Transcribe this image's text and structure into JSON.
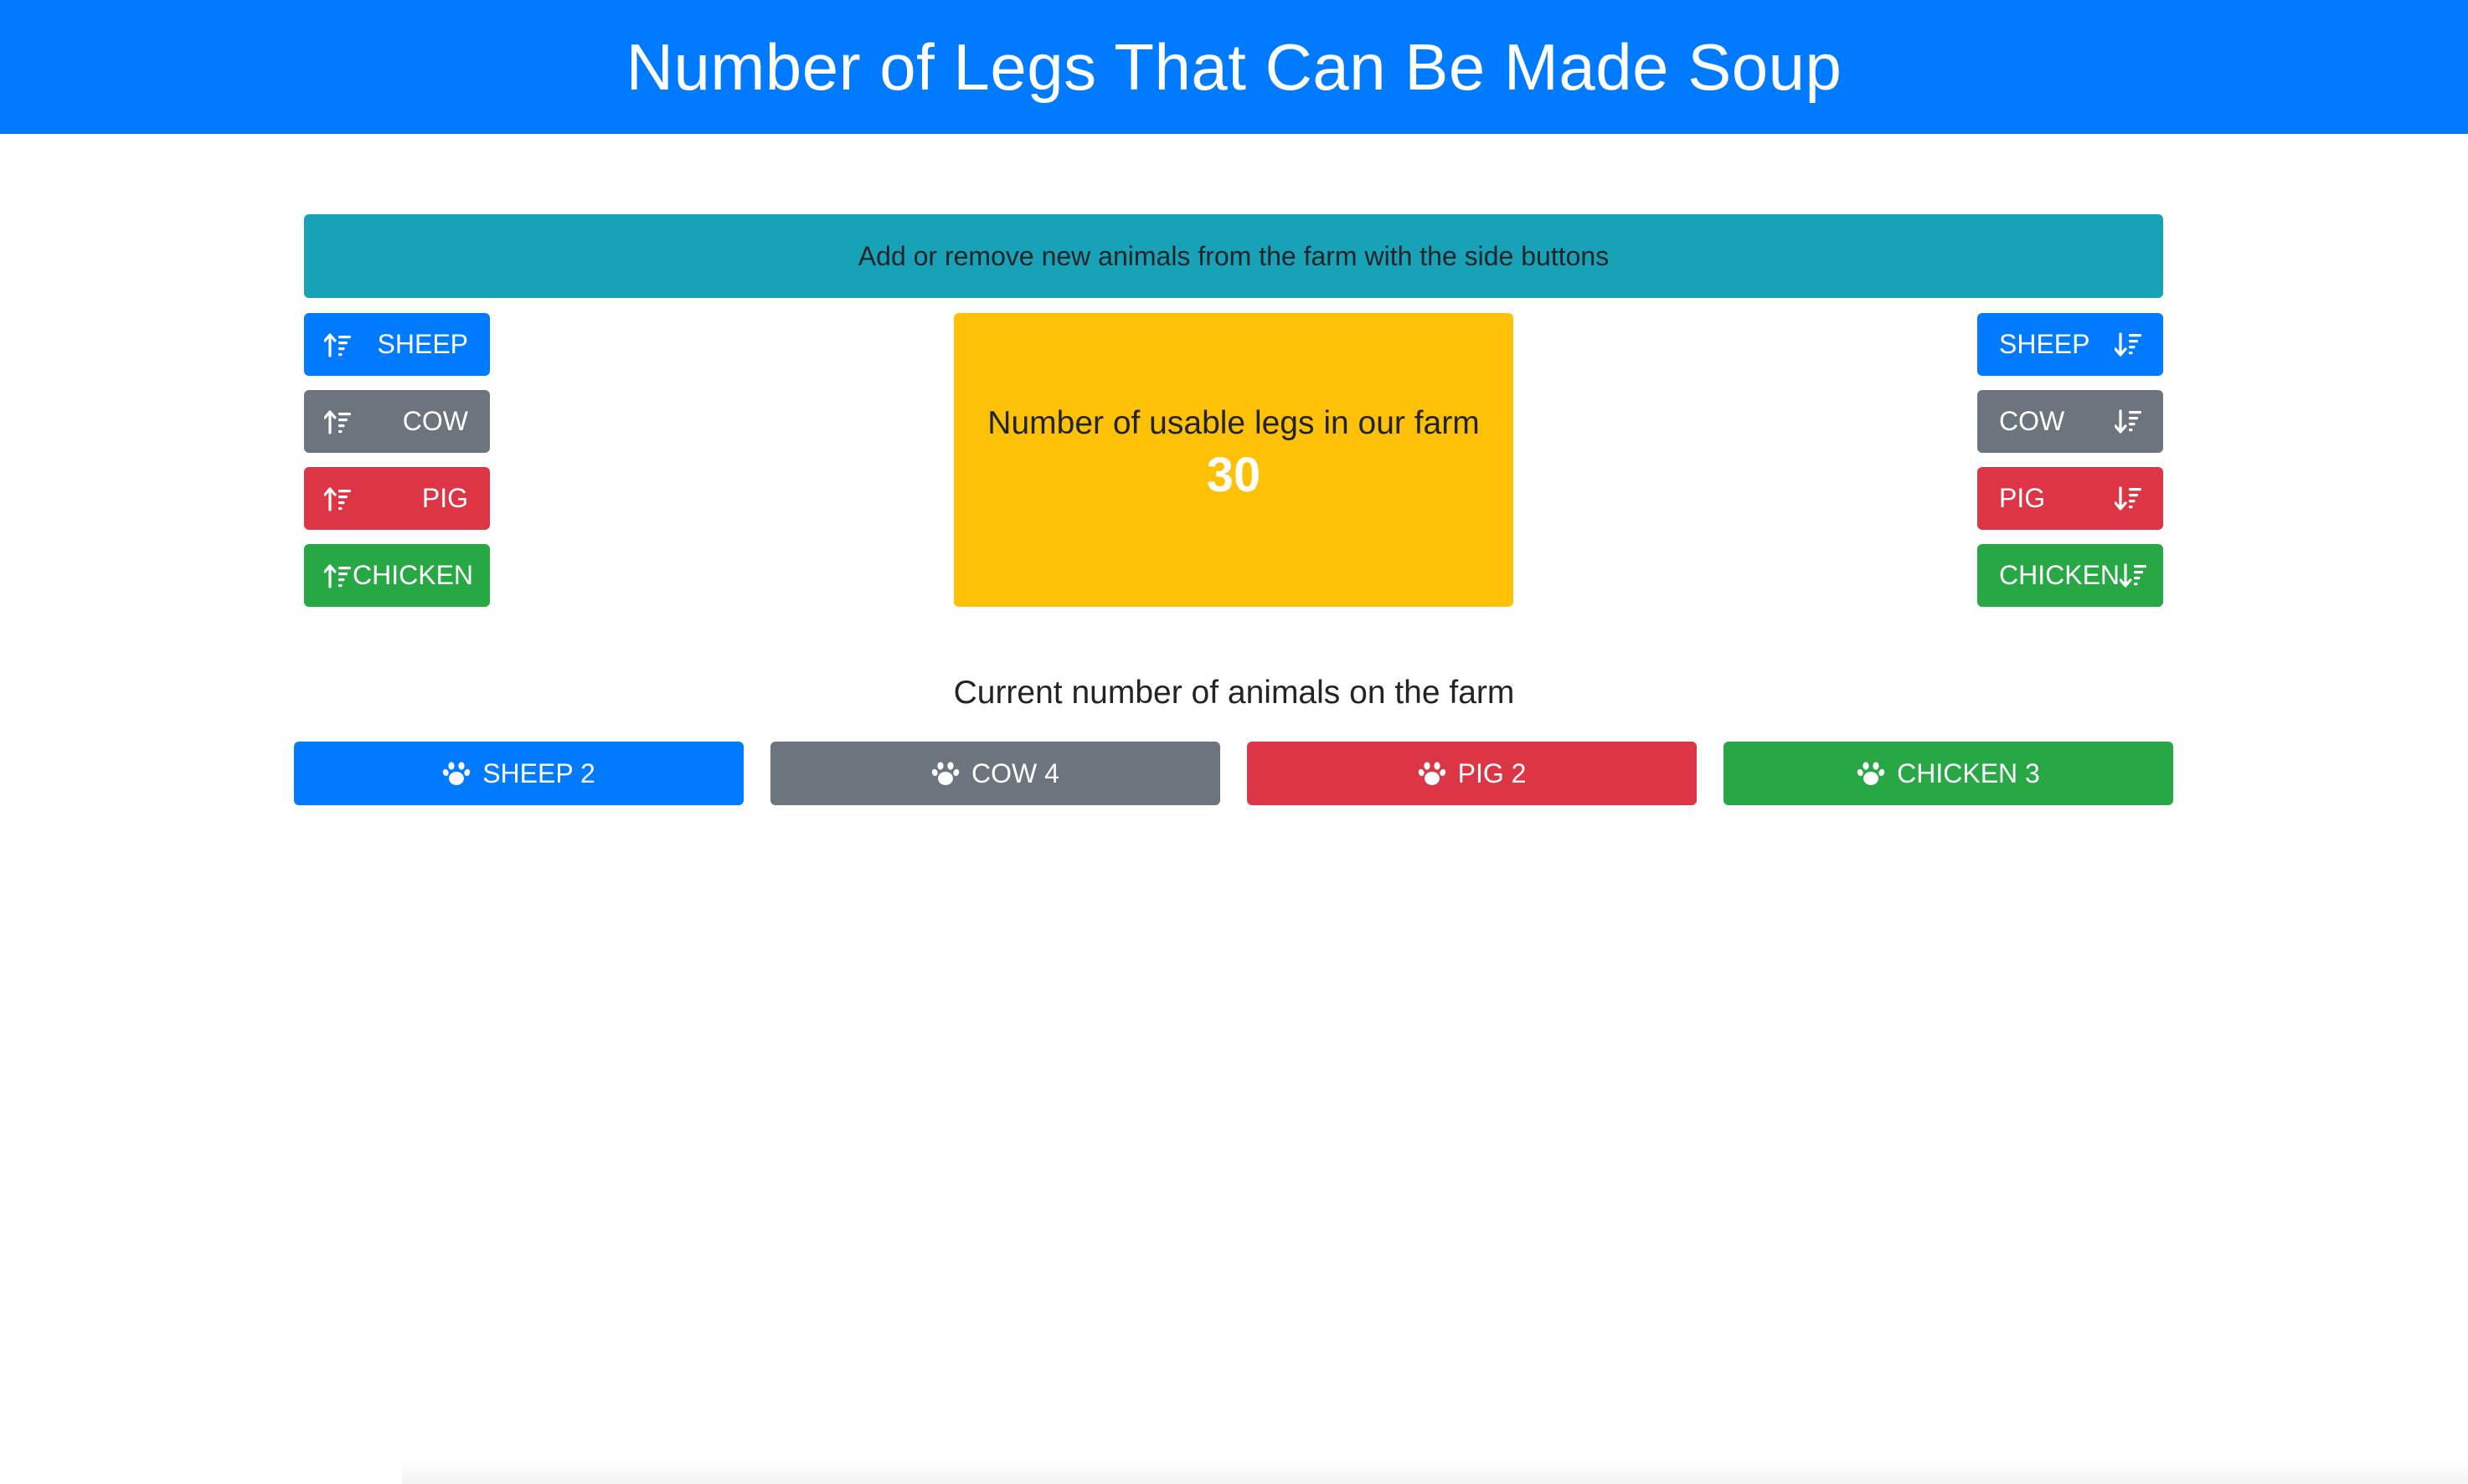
{
  "header": {
    "title": "Number of Legs That Can Be Made Soup"
  },
  "info": {
    "text": "Add or remove new animals from the farm with the side buttons"
  },
  "left_buttons": [
    {
      "label": "SHEEP",
      "icon": "sort-ascending-icon",
      "color": "#007bff"
    },
    {
      "label": "COW",
      "icon": "sort-ascending-icon",
      "color": "#6c757d"
    },
    {
      "label": "PIG",
      "icon": "sort-ascending-icon",
      "color": "#dc3545"
    },
    {
      "label": "CHICKEN",
      "icon": "sort-ascending-icon",
      "color": "#28a745"
    }
  ],
  "right_buttons": [
    {
      "label": "SHEEP",
      "icon": "sort-descending-icon",
      "color": "#007bff"
    },
    {
      "label": "COW",
      "icon": "sort-descending-icon",
      "color": "#6c757d"
    },
    {
      "label": "PIG",
      "icon": "sort-descending-icon",
      "color": "#dc3545"
    },
    {
      "label": "CHICKEN",
      "icon": "sort-descending-icon",
      "color": "#28a745"
    }
  ],
  "legs": {
    "label": "Number of usable legs in our farm",
    "value": "30",
    "color": "#ffc107"
  },
  "animals": {
    "title": "Current number of animals on the farm",
    "counts": [
      {
        "label": "SHEEP 2",
        "icon": "paw-icon",
        "color": "#007bff"
      },
      {
        "label": "COW 4",
        "icon": "paw-icon",
        "color": "#6c757d"
      },
      {
        "label": "PIG 2",
        "icon": "paw-icon",
        "color": "#dc3545"
      },
      {
        "label": "CHICKEN 3",
        "icon": "paw-icon",
        "color": "#28a745"
      }
    ]
  }
}
